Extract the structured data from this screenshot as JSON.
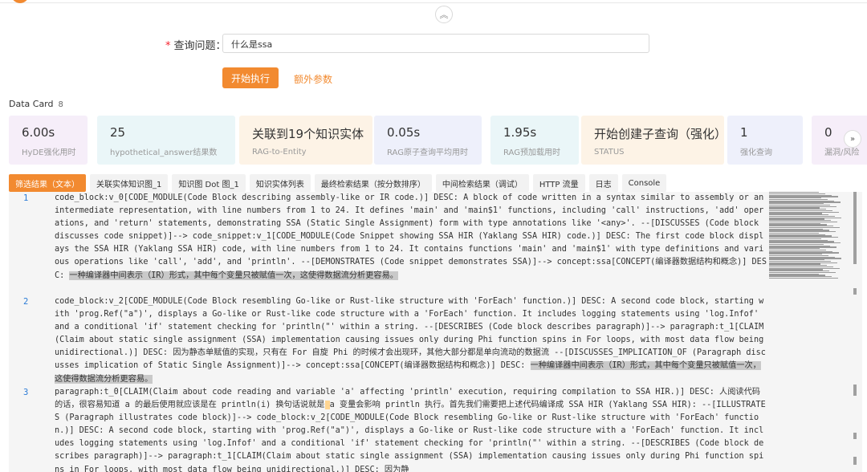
{
  "query": {
    "label": "查询问题：",
    "required_mark": "*",
    "value": "什么是ssa"
  },
  "actions": {
    "run_label": "开始执行",
    "extra_label": "额外参数"
  },
  "data_card": {
    "title": "Data Card",
    "count": "8",
    "cards": [
      {
        "value": "6.00s",
        "label": "HyDE强化用时",
        "bg": "#f6eef9"
      },
      {
        "value": "25",
        "label": "hypothetical_answer结果数",
        "bg": "#eaf6f8"
      },
      {
        "value": "关联到19个知识实体",
        "label": "RAG-to-Entity",
        "bg": "#fdf3e6"
      },
      {
        "value": "0.05s",
        "label": "RAG原子查询平均用时",
        "bg": "#eef0fb"
      },
      {
        "value": "1.95s",
        "label": "RAG预加载用时",
        "bg": "#eaf6f8"
      },
      {
        "value": "开始创建子查询（强化）",
        "label": "STATUS",
        "bg": "#fdf3e6"
      },
      {
        "value": "1",
        "label": "强化查询",
        "bg": "#eef0fb"
      },
      {
        "value": "0",
        "label": "漏洞/风险",
        "bg": "#f6eef9"
      }
    ]
  },
  "tabs": [
    {
      "label": "筛选结果（文本）",
      "active": true
    },
    {
      "label": "关联实体知识图_1"
    },
    {
      "label": "知识图 Dot 图_1"
    },
    {
      "label": "知识实体列表"
    },
    {
      "label": "最终检索结果（按分数排序）"
    },
    {
      "label": "中间检索结果（调试）"
    },
    {
      "label": "HTTP 流量"
    },
    {
      "label": "日志"
    },
    {
      "label": "Console"
    }
  ],
  "code": {
    "rows": [
      {
        "num": "1",
        "text": "code_block:v_0[CODE_MODULE(Code Block describing assembly-like or IR code.)] DESC: A block of code written in a syntax similar to assembly or an intermediate representation, with line numbers from 1 to 24. It defines 'main' and 'main$1' functions, including 'call' instructions, 'add' operations, and 'return' statements, demonstrating SSA (Static Single Assignment) form with type annotations like '<any>'. --[DISCUSSES (Code block discusses code snippet)]--> code_snippet:v_1[CODE_MODULE(Code Snippet showing SSA HIR (Yaklang SSA HIR) code.)] DESC: The first code block displays the SSA HIR (Yaklang SSA HIR) code, with line numbers from 1 to 24. It contains functions 'main' and 'main$1' with type definitions and various operations like 'call', 'add', and 'println'. --[DEMONSTRATES (Code snippet demonstrates SSA)]--> concept:ssa[CONCEPT(编译器数据结构和概念)] DESC: ",
        "hl": "一种编译器中间表示（IR）形式，其中每个变量只被赋值一次，这使得数据流分析更容易。"
      },
      {
        "num": "2",
        "text": "code_block:v_2[CODE_MODULE(Code Block resembling Go-like or Rust-like structure with 'ForEach' function.)] DESC: A second code block, starting with 'prog.Ref(\"a\")', displays a Go-like or Rust-like code structure with a 'ForEach' function. It includes logging statements using 'log.Infof' and a conditional 'if' statement checking for 'println(\"' within a string. --[DESCRIBES (Code block describes paragraph)]--> paragraph:t_1[CLAIM(Claim about static single assignment (SSA) implementation causing issues only during Phi function spins in For loops, with most data flow being unidirectional.)] DESC: 因为静态单赋值的实现，只有在 For 自旋 Phi 的时候才会出现环，其他大部分都是单向流动的数据流 --[DISCUSSES_IMPLICATION_OF (Paragraph discusses implication of Static Single Assignment)]--> concept:ssa[CONCEPT(编译器数据结构和概念)] DESC: ",
        "hl": "一种编译器中间表示（IR）形式，其中每个变量只被赋值一次，这使得数据流分析更容易。"
      },
      {
        "num": "3",
        "pre": "paragraph:t_0[CLAIM(Claim about code reading and variable 'a' affecting 'println' execution, requiring compilation to SSA HIR.)] DESC: 人阅读代码的话，很容易知道 a 的最后使用就应该是在 println(i) 换句话说就是",
        "caret": " ",
        "text": "a 变量会影响 println 执行。首先我们需要把上述代码编译成 SSA HIR (Yaklang SSA HIR): --[ILLUSTRATES (Paragraph illustrates code block)]--> code_block:v_2[CODE_MODULE(Code Block resembling Go-like or Rust-like structure with 'ForEach' function.)] DESC: A second code block, starting with 'prog.Ref(\"a\")', displays a Go-like or Rust-like code structure with a 'ForEach' function. It includes logging statements using 'log.Infof' and a conditional 'if' statement checking for 'println(\"' within a string. --[DESCRIBES (Code block describes paragraph)]--> paragraph:t_1[CLAIM(Claim about static single assignment (SSA) implementation causing issues only during Phi function spins in For loops, with most data flow being unidirectional.)] DESC: 因为静"
      }
    ]
  }
}
